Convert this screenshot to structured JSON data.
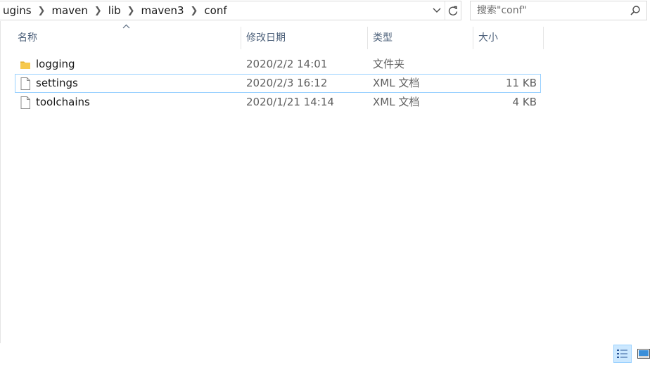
{
  "address_bar": {
    "crumbs": [
      "ugins",
      "maven",
      "lib",
      "maven3",
      "conf"
    ]
  },
  "search": {
    "placeholder": "搜索\"conf\""
  },
  "columns": {
    "name": "名称",
    "date": "修改日期",
    "type": "类型",
    "size": "大小"
  },
  "files": [
    {
      "name": "logging",
      "date": "2020/2/2 14:01",
      "type": "文件夹",
      "size": "",
      "icon": "folder-icon"
    },
    {
      "name": "settings",
      "date": "2020/2/3 16:12",
      "type": "XML 文档",
      "size": "11 KB",
      "icon": "file-icon"
    },
    {
      "name": "toolchains",
      "date": "2020/1/21 14:14",
      "type": "XML 文档",
      "size": "4 KB",
      "icon": "file-icon"
    }
  ],
  "colors": {
    "header_text": "#4c607a",
    "selection_border": "#99d1ff",
    "selection_fill": "#cce8ff",
    "folder": "#f6c94e"
  }
}
